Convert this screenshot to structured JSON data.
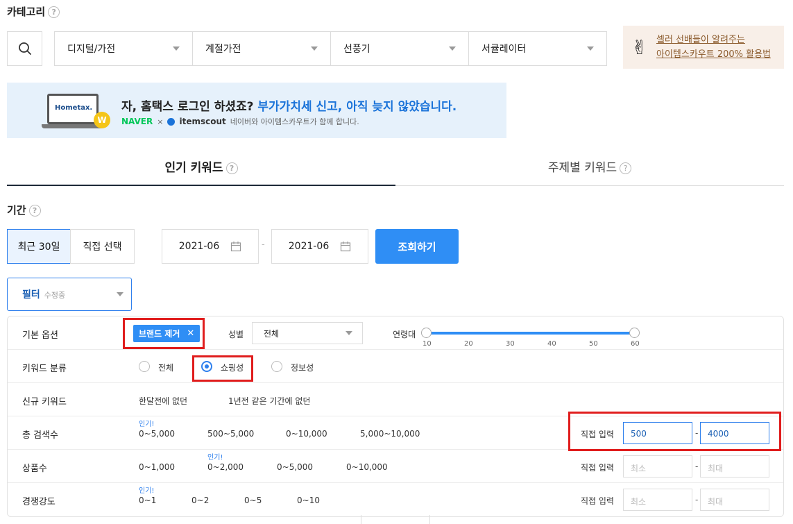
{
  "category": {
    "title": "카테고리",
    "selects": [
      "디지털/가전",
      "계절가전",
      "선풍기",
      "서큘레이터"
    ],
    "promo_line1": "셀러 선배들이 알려주는",
    "promo_line2": "아이템스카우트 200% 활용법"
  },
  "banner": {
    "head_black": "자, 홈택스 로그인 하셨죠?",
    "head_blue": "부가가치세 신고, 아직 늦지 않았습니다.",
    "brand_naver": "NAVER",
    "times": "×",
    "brand_items": "itemscout",
    "sub": "네이버와 아이템스카우트가 함께 합니다.",
    "logo_text": "Hometax.",
    "coin": "W"
  },
  "tabs": {
    "popular": "인기 키워드",
    "topic": "주제별 키워드"
  },
  "period": {
    "title": "기간",
    "recent": "최근 30일",
    "direct": "직접 선택",
    "from": "2021-06",
    "to": "2021-06",
    "dash": "-",
    "submit": "조회하기"
  },
  "filter": {
    "label": "필터",
    "sub": "수정중"
  },
  "panel": {
    "basic": {
      "label": "기본 옵션",
      "tag": "브랜드 제거",
      "gender_label": "성별",
      "gender_value": "전체",
      "age_label": "연령대",
      "age_ticks": [
        "10",
        "20",
        "30",
        "40",
        "50",
        "60"
      ]
    },
    "kwtype": {
      "label": "키워드 분류",
      "options": [
        "전체",
        "쇼핑성",
        "정보성"
      ],
      "selected": "쇼핑성"
    },
    "newkw": {
      "label": "신규 키워드",
      "options": [
        "한달전에 없던",
        "1년전 같은 기간에 없던"
      ]
    },
    "total": {
      "label": "총 검색수",
      "hot": "인기!",
      "options": [
        "0~5,000",
        "500~5,000",
        "0~10,000",
        "5,000~10,000"
      ],
      "direct": "직접 입력",
      "min": "500",
      "max": "4000"
    },
    "products": {
      "label": "상품수",
      "hot": "인기!",
      "options": [
        "0~1,000",
        "0~2,000",
        "0~5,000",
        "0~10,000"
      ],
      "direct": "직접 입력",
      "min_ph": "최소",
      "max_ph": "최대"
    },
    "competition": {
      "label": "경쟁강도",
      "hot": "인기!",
      "options": [
        "0~1",
        "0~2",
        "0~5",
        "0~10"
      ],
      "direct": "직접 입력",
      "min_ph": "최소",
      "max_ph": "최대"
    }
  },
  "colors": {
    "accent": "#2f8ef5",
    "highlight": "#e01d1d"
  }
}
